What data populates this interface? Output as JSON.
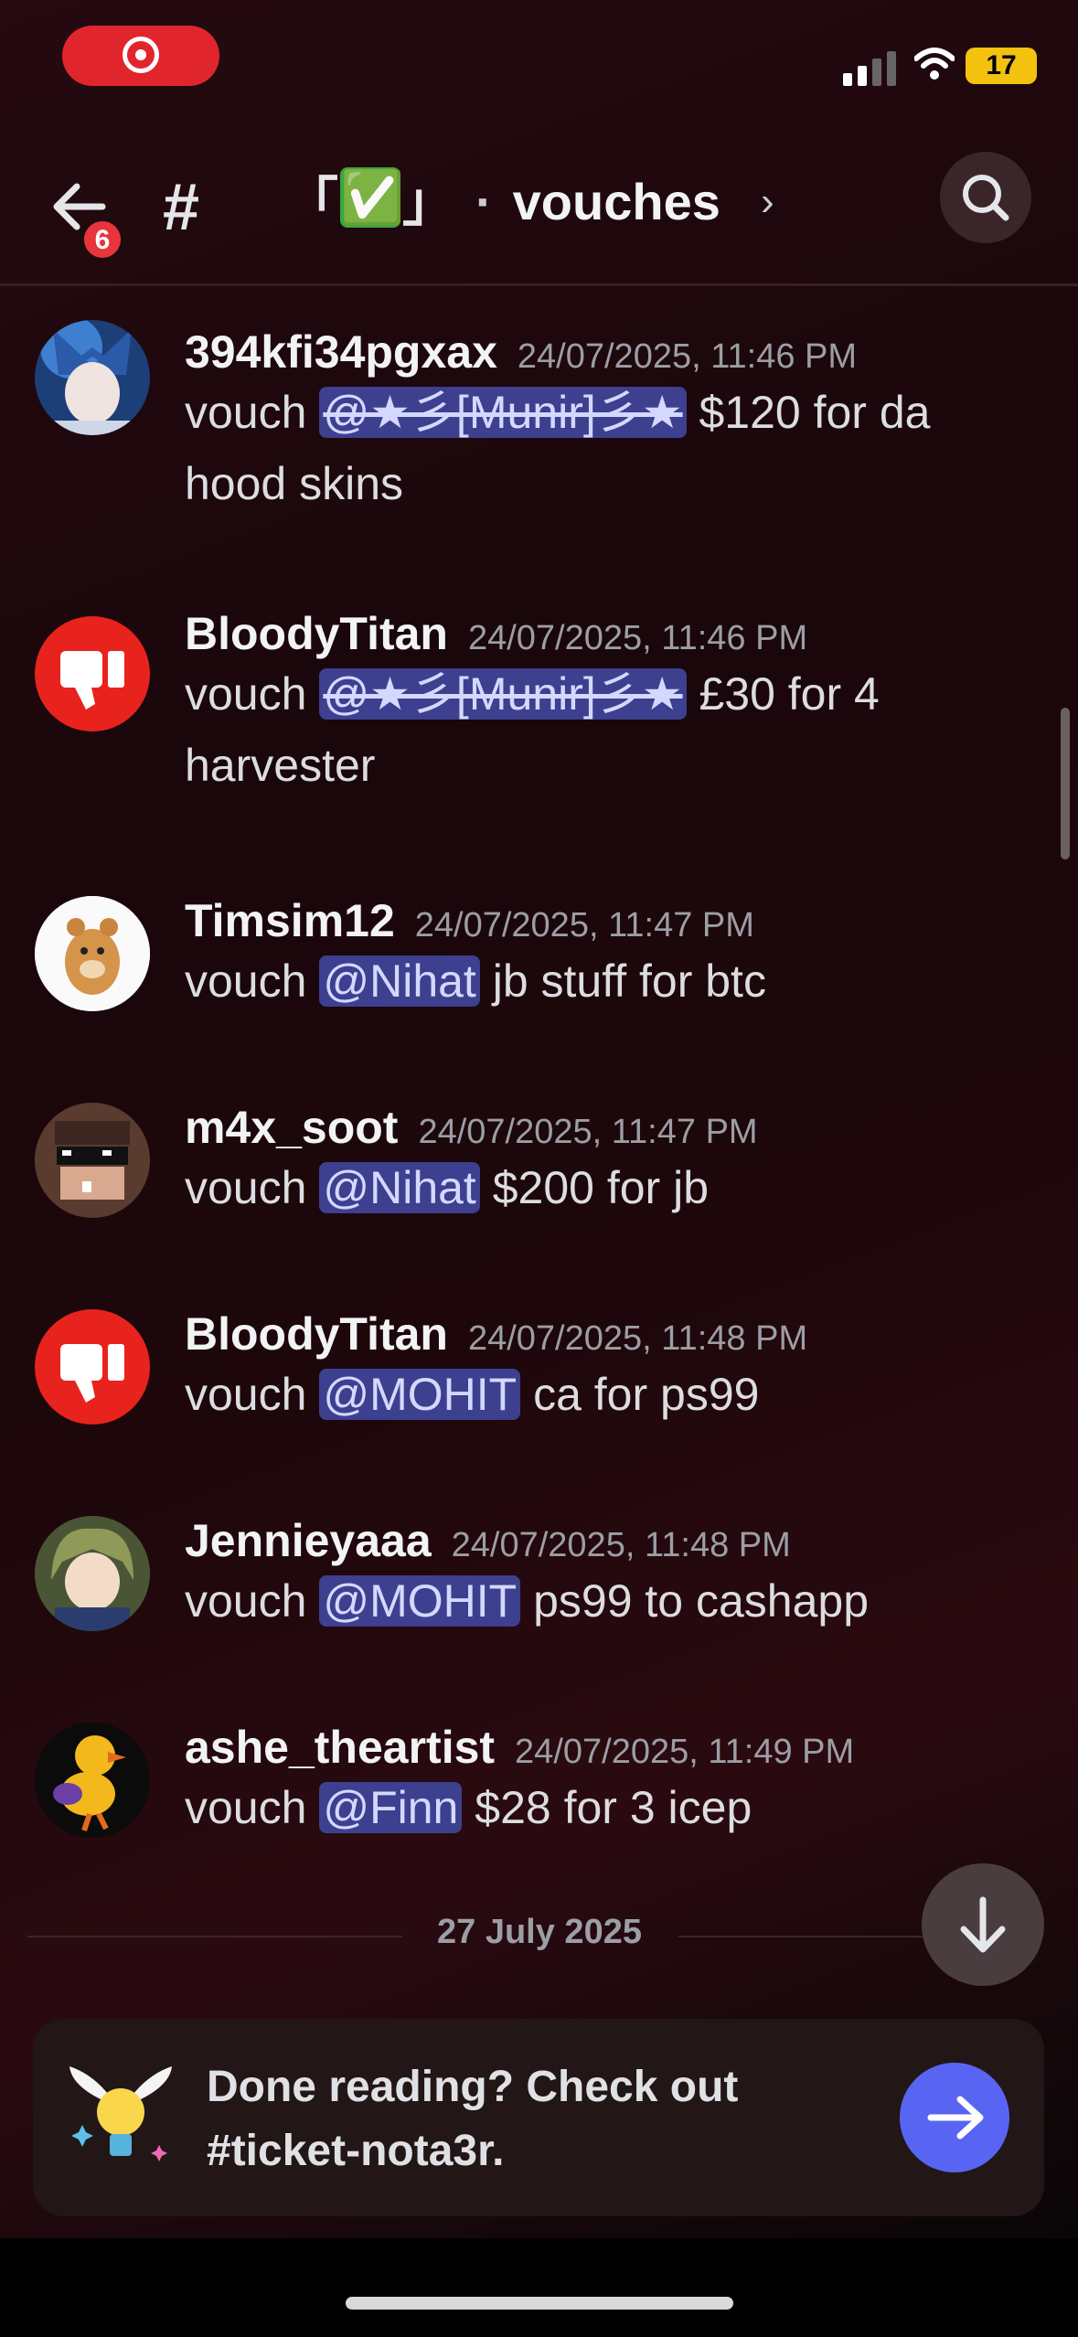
{
  "status": {
    "battery": "17"
  },
  "header": {
    "badge_count": "6",
    "hash": "#",
    "emoji_open": "「",
    "emoji_check": "✅",
    "emoji_close": "」",
    "dot": "·",
    "channel_name": "vouches",
    "chevron": "›"
  },
  "messages": [
    {
      "author": "394kfi34pgxax",
      "timestamp": "24/07/2025, 11:46 PM",
      "prefix": "vouch",
      "mention": "@★彡[Munir]彡★",
      "suffix": "$120 for da hood skins"
    },
    {
      "author": "BloodyTitan",
      "timestamp": "24/07/2025, 11:46 PM",
      "prefix": "vouch",
      "mention": "@★彡[Munir]彡★",
      "suffix": "£30 for 4 harvester"
    },
    {
      "author": "Timsim12",
      "timestamp": "24/07/2025, 11:47 PM",
      "prefix": "vouch",
      "mention": "@Nihat",
      "suffix": "jb stuff for btc"
    },
    {
      "author": "m4x_soot",
      "timestamp": "24/07/2025, 11:47 PM",
      "prefix": "vouch",
      "mention": "@Nihat",
      "suffix": "$200 for jb"
    },
    {
      "author": "BloodyTitan",
      "timestamp": "24/07/2025, 11:48 PM",
      "prefix": "vouch",
      "mention": "@MOHIT",
      "suffix": "ca for ps99"
    },
    {
      "author": "Jennieyaaa",
      "timestamp": "24/07/2025, 11:48 PM",
      "prefix": "vouch",
      "mention": "@MOHIT",
      "suffix": "ps99 to cashapp"
    },
    {
      "author": "ashe_theartist",
      "timestamp": "24/07/2025, 11:49 PM",
      "prefix": "vouch",
      "mention": "@Finn",
      "suffix": "$28 for 3 icep"
    }
  ],
  "date_divider": "27 July 2025",
  "banner": {
    "text": "Done reading? Check out #ticket-nota3r."
  },
  "colors": {
    "mention_bg": "#3d3f8f",
    "accent_button": "#5865f2",
    "badge": "#e8343b",
    "record": "#e0262c"
  }
}
